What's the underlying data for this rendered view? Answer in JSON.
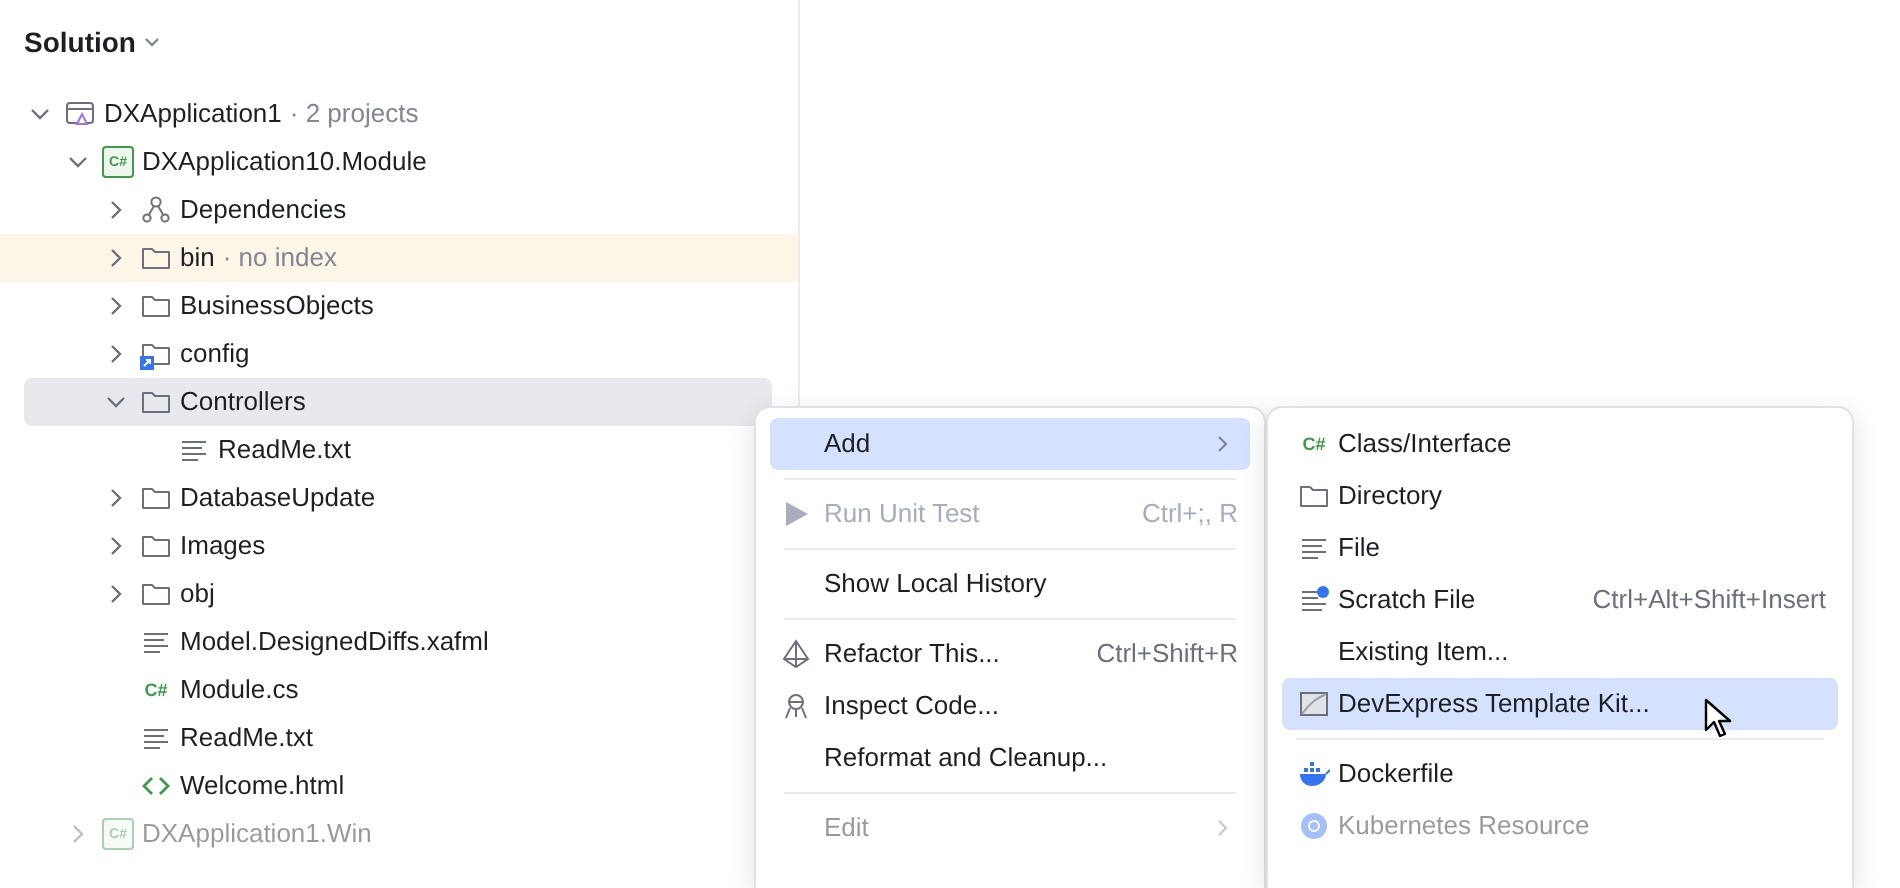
{
  "panel": {
    "title": "Solution"
  },
  "tree": [
    {
      "label": "DXApplication1",
      "note": "· 2 projects",
      "kind": "solution",
      "expanded": true,
      "selected": false,
      "highlighted": false,
      "faded": false,
      "children": [
        {
          "label": "DXApplication10.Module",
          "kind": "csharp-project",
          "icon_text": "C#",
          "expanded": true,
          "selected": false,
          "highlighted": false,
          "faded": false,
          "children": [
            {
              "label": "Dependencies",
              "kind": "dependencies",
              "expanded": false,
              "selected": false,
              "highlighted": false,
              "faded": false
            },
            {
              "label": "bin",
              "note": "· no index",
              "kind": "folder",
              "expanded": false,
              "selected": false,
              "highlighted": true,
              "faded": false
            },
            {
              "label": "BusinessObjects",
              "kind": "folder",
              "expanded": false,
              "selected": false,
              "highlighted": false,
              "faded": false
            },
            {
              "label": "config",
              "kind": "folder-link",
              "expanded": false,
              "selected": false,
              "highlighted": false,
              "faded": false
            },
            {
              "label": "Controllers",
              "kind": "folder",
              "expanded": true,
              "selected": true,
              "highlighted": false,
              "faded": false,
              "children": [
                {
                  "label": "ReadMe.txt",
                  "kind": "text-file",
                  "selected": false,
                  "highlighted": false,
                  "faded": false
                }
              ]
            },
            {
              "label": "DatabaseUpdate",
              "kind": "folder",
              "expanded": false,
              "selected": false,
              "highlighted": false,
              "faded": false
            },
            {
              "label": "Images",
              "kind": "folder",
              "expanded": false,
              "selected": false,
              "highlighted": false,
              "faded": false
            },
            {
              "label": "obj",
              "kind": "folder",
              "expanded": false,
              "selected": false,
              "highlighted": false,
              "faded": false
            },
            {
              "label": "Model.DesignedDiffs.xafml",
              "kind": "text-file",
              "selected": false,
              "highlighted": false,
              "faded": false
            },
            {
              "label": "Module.cs",
              "kind": "csharp-file",
              "icon_text": "C#",
              "selected": false,
              "highlighted": false,
              "faded": false
            },
            {
              "label": "ReadMe.txt",
              "kind": "text-file",
              "selected": false,
              "highlighted": false,
              "faded": false
            },
            {
              "label": "Welcome.html",
              "kind": "html-file",
              "selected": false,
              "highlighted": false,
              "faded": false
            }
          ]
        },
        {
          "label": "DXApplication1.Win",
          "kind": "csharp-project",
          "icon_text": "C#",
          "expanded": false,
          "selected": false,
          "highlighted": false,
          "faded": true
        }
      ]
    }
  ],
  "context_menu": [
    {
      "kind": "plain",
      "label": "Add",
      "submenu": true,
      "selected": true,
      "disabled": false,
      "faded": false
    },
    {
      "kind": "separator"
    },
    {
      "kind": "run",
      "label": "Run Unit Test",
      "shortcut": "Ctrl+;, R",
      "selected": false,
      "disabled": true,
      "faded": false
    },
    {
      "kind": "separator"
    },
    {
      "kind": "plain",
      "label": "Show Local History",
      "selected": false,
      "disabled": false,
      "faded": false
    },
    {
      "kind": "separator"
    },
    {
      "kind": "refactor",
      "label": "Refactor This...",
      "shortcut": "Ctrl+Shift+R",
      "selected": false,
      "disabled": false,
      "faded": false
    },
    {
      "kind": "inspect",
      "label": "Inspect Code...",
      "selected": false,
      "disabled": false,
      "faded": false
    },
    {
      "kind": "plain",
      "label": "Reformat and Cleanup...",
      "selected": false,
      "disabled": false,
      "faded": false
    },
    {
      "kind": "separator"
    },
    {
      "kind": "plain",
      "label": "Edit",
      "submenu": true,
      "selected": false,
      "disabled": false,
      "faded": true
    }
  ],
  "add_submenu": [
    {
      "kind": "csharp-file",
      "icon_text": "C#",
      "label": "Class/Interface",
      "selected": false,
      "disabled": false,
      "faded": false
    },
    {
      "kind": "folder",
      "label": "Directory",
      "selected": false,
      "disabled": false,
      "faded": false
    },
    {
      "kind": "text-file",
      "label": "File",
      "selected": false,
      "disabled": false,
      "faded": false
    },
    {
      "kind": "scratch",
      "label": "Scratch File",
      "shortcut": "Ctrl+Alt+Shift+Insert",
      "selected": false,
      "disabled": false,
      "faded": false
    },
    {
      "kind": "plain",
      "label": "Existing Item...",
      "selected": false,
      "disabled": false,
      "faded": false
    },
    {
      "kind": "template",
      "label": "DevExpress Template Kit...",
      "selected": true,
      "disabled": false,
      "faded": false
    },
    {
      "kind": "separator"
    },
    {
      "kind": "docker",
      "label": "Dockerfile",
      "selected": false,
      "disabled": false,
      "faded": false
    },
    {
      "kind": "kubernetes",
      "label": "Kubernetes Resource",
      "selected": false,
      "disabled": false,
      "faded": true
    }
  ]
}
